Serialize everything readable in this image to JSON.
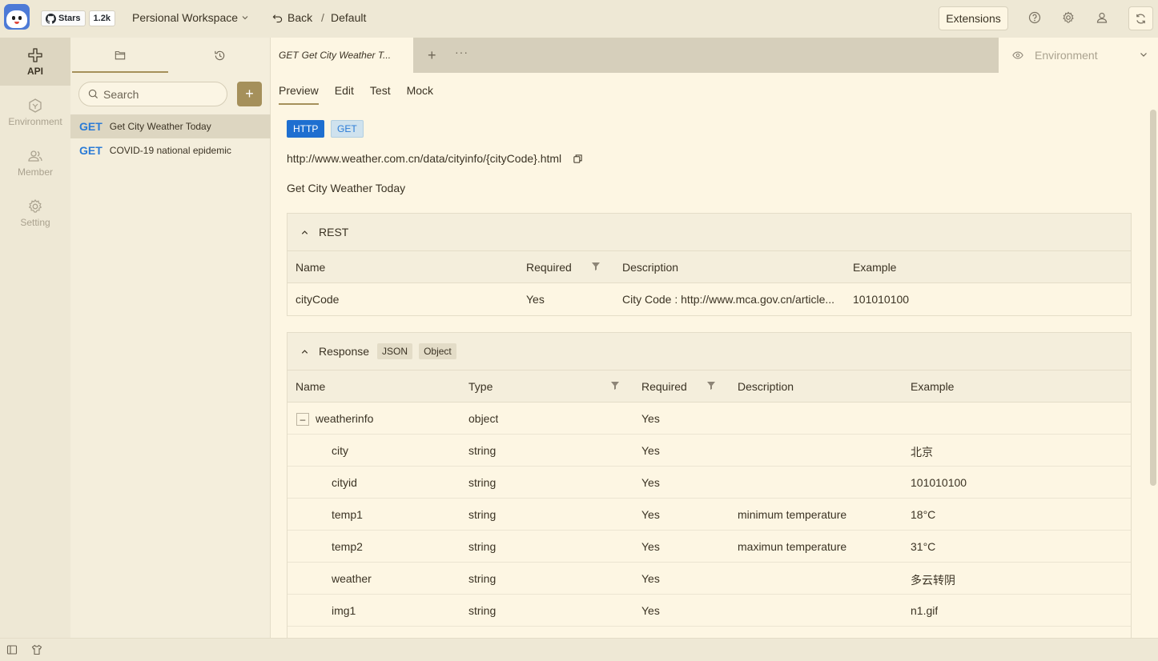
{
  "topbar": {
    "github_stars_label": "Stars",
    "github_stars_count": "1.2k",
    "workspace": "Persional Workspace",
    "back_label": "Back",
    "breadcrumb_sep": "/",
    "breadcrumb_current": "Default",
    "extensions_label": "Extensions"
  },
  "rail": {
    "items": [
      {
        "label": "API",
        "icon": "api-icon",
        "active": true
      },
      {
        "label": "Environment",
        "icon": "environment-icon",
        "active": false
      },
      {
        "label": "Member",
        "icon": "member-icon",
        "active": false
      },
      {
        "label": "Setting",
        "icon": "setting-icon",
        "active": false
      }
    ]
  },
  "sidepanel": {
    "tabs": [
      {
        "icon": "folder-icon",
        "active": true
      },
      {
        "icon": "history-icon",
        "active": false
      }
    ],
    "search_placeholder": "Search",
    "add_label": "+",
    "apis": [
      {
        "method": "GET",
        "name": "Get City Weather Today",
        "active": true
      },
      {
        "method": "GET",
        "name": "COVID-19 national epidemic",
        "active": false
      }
    ]
  },
  "main": {
    "open_tab": {
      "method": "GET",
      "title": "Get City Weather T..."
    },
    "env_label": "Environment",
    "subtabs": [
      "Preview",
      "Edit",
      "Test",
      "Mock"
    ],
    "protocol": "HTTP",
    "method": "GET",
    "url": "http://www.weather.com.cn/data/cityinfo/{cityCode}.html",
    "description": "Get City Weather Today",
    "rest": {
      "title": "REST",
      "columns": [
        "Name",
        "Required",
        "Description",
        "Example"
      ],
      "rows": [
        {
          "name": "cityCode",
          "required": "Yes",
          "description": "City Code : http://www.mca.gov.cn/article...",
          "example": "101010100"
        }
      ]
    },
    "response": {
      "title": "Response",
      "tags": [
        "JSON",
        "Object"
      ],
      "columns": [
        "Name",
        "Type",
        "Required",
        "Description",
        "Example"
      ],
      "rows": [
        {
          "name": "weatherinfo",
          "type": "object",
          "required": "Yes",
          "description": "",
          "example": "",
          "level": 0,
          "expandable": true,
          "expander": "–"
        },
        {
          "name": "city",
          "type": "string",
          "required": "Yes",
          "description": "",
          "example": "北京",
          "level": 1
        },
        {
          "name": "cityid",
          "type": "string",
          "required": "Yes",
          "description": "",
          "example": "101010100",
          "level": 1
        },
        {
          "name": "temp1",
          "type": "string",
          "required": "Yes",
          "description": "minimum temperature",
          "example": "18°C",
          "level": 1
        },
        {
          "name": "temp2",
          "type": "string",
          "required": "Yes",
          "description": "maximun temperature",
          "example": "31°C",
          "level": 1
        },
        {
          "name": "weather",
          "type": "string",
          "required": "Yes",
          "description": "",
          "example": "多云转阴",
          "level": 1
        },
        {
          "name": "img1",
          "type": "string",
          "required": "Yes",
          "description": "",
          "example": "n1.gif",
          "level": 1
        }
      ]
    }
  },
  "colors": {
    "accent": "#a5905b",
    "method_get": "#2a7bd6",
    "http_badge": "#1e6fd0",
    "background": "#fdf6e3",
    "chrome": "#eee8d5"
  }
}
